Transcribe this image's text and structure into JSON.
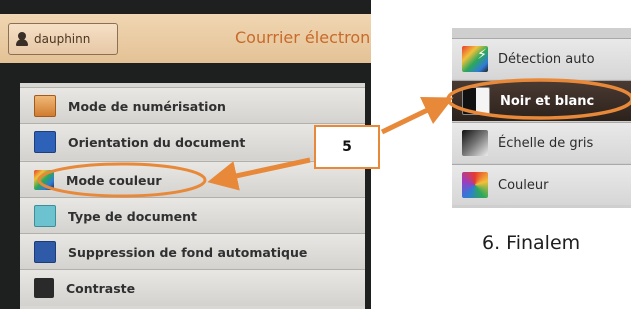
{
  "left_screen": {
    "user_label": "dauphinn",
    "title": "Courrier électron",
    "menu": [
      {
        "label": "Mode de numérisation",
        "icon": "scan-mode-icon"
      },
      {
        "label": "Orientation du document",
        "icon": "orientation-icon"
      },
      {
        "label": "Mode couleur",
        "icon": "color-mode-icon"
      },
      {
        "label": "Type de document",
        "icon": "document-type-icon"
      },
      {
        "label": "Suppression de fond automatique",
        "icon": "background-suppression-icon"
      },
      {
        "label": "Contraste",
        "icon": "contrast-icon"
      }
    ]
  },
  "callout": {
    "number": "5"
  },
  "right_screen": {
    "options": [
      {
        "label": "Détection auto",
        "icon": "auto-detect-icon"
      },
      {
        "label": "Noir et blanc",
        "icon": "black-white-icon",
        "selected": true
      },
      {
        "label": "Échelle de gris",
        "icon": "grayscale-icon"
      },
      {
        "label": "Couleur",
        "icon": "color-icon"
      }
    ]
  },
  "caption": "6. Finalem",
  "colors": {
    "annotation_orange": "#e8893a",
    "title_orange": "#c86a2a",
    "selected_row": "#2c221c"
  }
}
